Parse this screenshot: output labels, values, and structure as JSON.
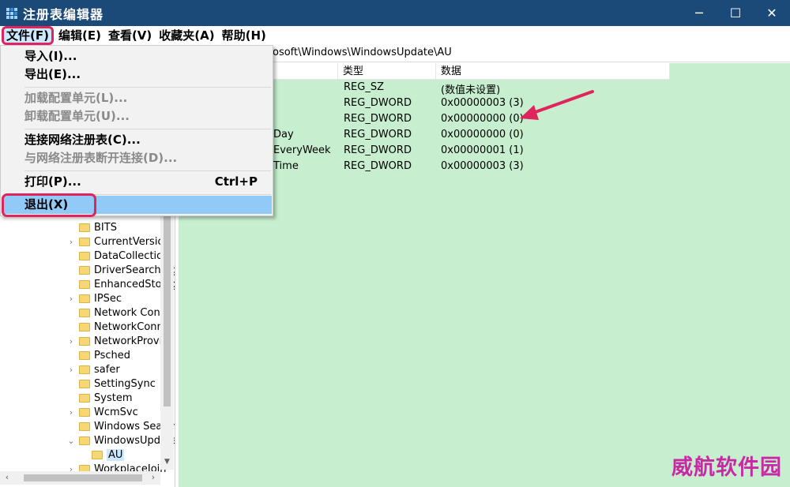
{
  "window": {
    "title": "注册表编辑器",
    "controls": {
      "minimize": "─",
      "maximize": "☐",
      "close": "✕"
    }
  },
  "menubar": {
    "items": [
      {
        "label": "文件(F)",
        "active": true
      },
      {
        "label": "编辑(E)"
      },
      {
        "label": "查看(V)"
      },
      {
        "label": "收藏夹(A)"
      },
      {
        "label": "帮助(H)"
      }
    ]
  },
  "address": {
    "path": "osoft\\Windows\\WindowsUpdate\\AU"
  },
  "file_menu": {
    "items": [
      {
        "label": "导入(I)...",
        "disabled": false
      },
      {
        "label": "导出(E)...",
        "disabled": false
      },
      {
        "label": "加载配置单元(L)...",
        "disabled": true
      },
      {
        "label": "卸载配置单元(U)...",
        "disabled": true
      },
      {
        "label": "连接网络注册表(C)...",
        "disabled": false
      },
      {
        "label": "与网络注册表断开连接(D)...",
        "disabled": true
      },
      {
        "label": "打印(P)...",
        "shortcut": "Ctrl+P",
        "disabled": false
      },
      {
        "label": "退出(X)",
        "disabled": false,
        "hover": true
      }
    ]
  },
  "tree": {
    "items": [
      {
        "label": "BITS",
        "expandable": false
      },
      {
        "label": "CurrentVersion",
        "expandable": true
      },
      {
        "label": "DataCollection",
        "expandable": false
      },
      {
        "label": "DriverSearching",
        "expandable": false
      },
      {
        "label": "EnhancedStorage",
        "expandable": false
      },
      {
        "label": "IPSec",
        "expandable": true
      },
      {
        "label": "Network Conn",
        "expandable": false
      },
      {
        "label": "NetworkConne",
        "expandable": false
      },
      {
        "label": "NetworkProvid",
        "expandable": true
      },
      {
        "label": "Psched",
        "expandable": false
      },
      {
        "label": "safer",
        "expandable": true
      },
      {
        "label": "SettingSync",
        "expandable": false
      },
      {
        "label": "System",
        "expandable": false
      },
      {
        "label": "WcmSvc",
        "expandable": true
      },
      {
        "label": "Windows Search",
        "expandable": false
      },
      {
        "label": "WindowsUpdate",
        "expandable": "open"
      },
      {
        "label": "AU",
        "selected": true
      },
      {
        "label": "WorkplaceJoin",
        "expandable": false
      }
    ]
  },
  "values": {
    "headers": {
      "name": "",
      "type": "类型",
      "data": "数据"
    },
    "rows": [
      {
        "name": "",
        "type": "REG_SZ",
        "data": "(数值未设置)"
      },
      {
        "name": "",
        "type": "REG_DWORD",
        "data": "0x00000003 (3)"
      },
      {
        "name": "",
        "type": "REG_DWORD",
        "data": "0x00000000 (0)"
      },
      {
        "name": "Day",
        "type": "REG_DWORD",
        "data": "0x00000000 (0)"
      },
      {
        "name": "EveryWeek",
        "type": "REG_DWORD",
        "data": "0x00000001 (1)"
      },
      {
        "name": "Time",
        "type": "REG_DWORD",
        "data": "0x00000003 (3)"
      }
    ]
  },
  "watermark": "威航软件园",
  "colors": {
    "titlebar": "#1b4a78",
    "values_bg": "#c7efcf",
    "highlight": "#e0245e",
    "menu_hover": "#91c9f7"
  }
}
